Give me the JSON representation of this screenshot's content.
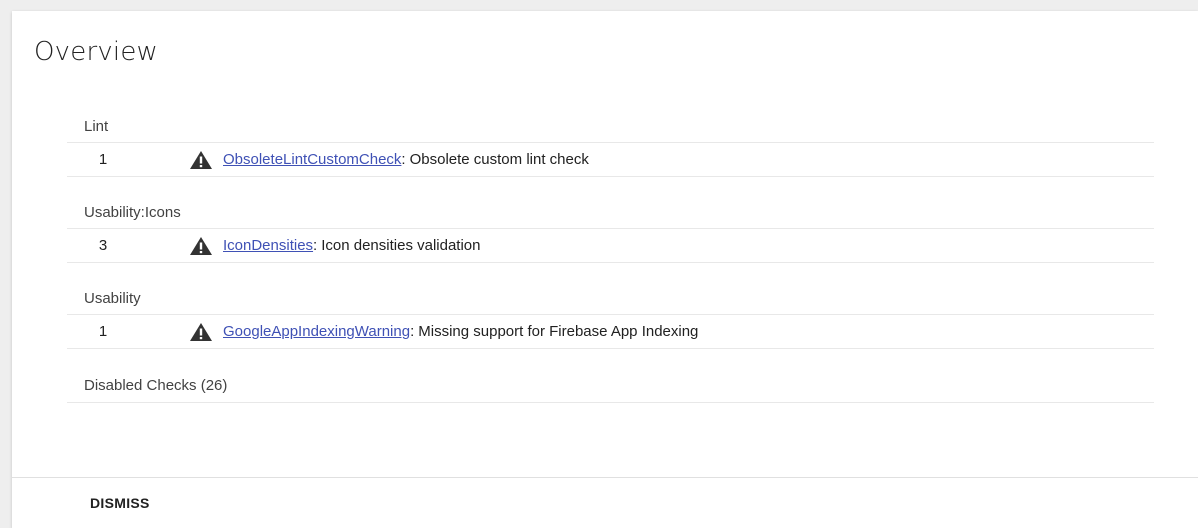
{
  "overview": {
    "title": "Overview"
  },
  "groups": [
    {
      "category": "Lint",
      "issue": {
        "count": "1",
        "icon": "warning-icon",
        "link": "ObsoleteLintCustomCheck",
        "separator": ":",
        "description": "Obsolete custom lint check"
      }
    },
    {
      "category": "Usability:Icons",
      "issue": {
        "count": "3",
        "icon": "warning-icon",
        "link": "IconDensities",
        "separator": ":",
        "description": "Icon densities validation"
      }
    },
    {
      "category": "Usability",
      "issue": {
        "count": "1",
        "icon": "warning-icon",
        "link": "GoogleAppIndexingWarning",
        "separator": ":",
        "description": "Missing support for Firebase App Indexing"
      }
    }
  ],
  "disabled_checks": {
    "label": "Disabled Checks (26)"
  },
  "footer": {
    "dismiss_label": "DISMISS"
  },
  "colors": {
    "link": "#3f51b5",
    "icon": "#333333"
  }
}
